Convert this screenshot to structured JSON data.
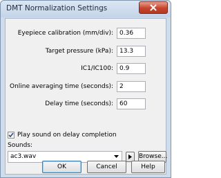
{
  "window": {
    "title": "DMT Normalization Settings",
    "close_icon": "close-icon"
  },
  "fields": [
    {
      "label": "Eyepiece calibration (mm/div):",
      "value": "0.36"
    },
    {
      "label": "Target pressure (kPa):",
      "value": "13.3"
    },
    {
      "label": "IC1/IC100:",
      "value": "0.9"
    },
    {
      "label": "Online averaging time (seconds):",
      "value": "2"
    },
    {
      "label": "Delay time (seconds):",
      "value": "60"
    }
  ],
  "play_sound": {
    "label": "Play sound on delay completion",
    "checked": true
  },
  "sounds": {
    "label": "Sounds:",
    "selected": "ac3.wav",
    "play_icon": "play-icon",
    "browse_label": "Browse..."
  },
  "buttons": {
    "ok": "OK",
    "cancel": "Cancel",
    "help": "Help"
  }
}
